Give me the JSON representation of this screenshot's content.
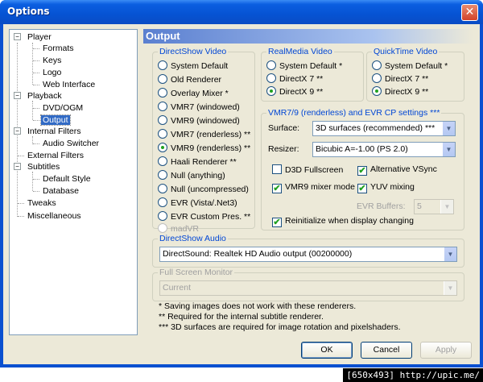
{
  "window": {
    "title": "Options",
    "close_glyph": "✕"
  },
  "tree": {
    "items": [
      {
        "label": "Player",
        "expander": "−"
      },
      {
        "label": "Formats"
      },
      {
        "label": "Keys"
      },
      {
        "label": "Logo"
      },
      {
        "label": "Web Interface"
      },
      {
        "label": "Playback",
        "expander": "−"
      },
      {
        "label": "DVD/OGM"
      },
      {
        "label": "Output",
        "selected": true
      },
      {
        "label": "Internal Filters",
        "expander": "−"
      },
      {
        "label": "Audio Switcher"
      },
      {
        "label": "External Filters"
      },
      {
        "label": "Subtitles",
        "expander": "−"
      },
      {
        "label": "Default Style"
      },
      {
        "label": "Database"
      },
      {
        "label": "Tweaks"
      },
      {
        "label": "Miscellaneous"
      }
    ]
  },
  "page": {
    "title": "Output"
  },
  "directshow_video": {
    "title": "DirectShow Video",
    "options": [
      {
        "label": "System Default",
        "checked": false,
        "enabled": true
      },
      {
        "label": "Old Renderer",
        "checked": false,
        "enabled": true
      },
      {
        "label": "Overlay Mixer *",
        "checked": false,
        "enabled": true
      },
      {
        "label": "VMR7 (windowed)",
        "checked": false,
        "enabled": true
      },
      {
        "label": "VMR9 (windowed)",
        "checked": false,
        "enabled": true
      },
      {
        "label": "VMR7 (renderless) **",
        "checked": false,
        "enabled": true
      },
      {
        "label": "VMR9 (renderless) **",
        "checked": true,
        "enabled": true
      },
      {
        "label": "Haali Renderer **",
        "checked": false,
        "enabled": true
      },
      {
        "label": "Null (anything)",
        "checked": false,
        "enabled": true
      },
      {
        "label": "Null (uncompressed)",
        "checked": false,
        "enabled": true
      },
      {
        "label": "EVR (Vista/.Net3)",
        "checked": false,
        "enabled": true
      },
      {
        "label": "EVR Custom Pres. **",
        "checked": false,
        "enabled": true
      },
      {
        "label": "madVR",
        "checked": false,
        "enabled": false
      }
    ]
  },
  "realmedia_video": {
    "title": "RealMedia Video",
    "options": [
      {
        "label": "System Default *",
        "checked": false
      },
      {
        "label": "DirectX 7 **",
        "checked": false
      },
      {
        "label": "DirectX 9 **",
        "checked": true
      }
    ]
  },
  "quicktime_video": {
    "title": "QuickTime Video",
    "options": [
      {
        "label": "System Default *",
        "checked": false
      },
      {
        "label": "DirectX 7 **",
        "checked": false
      },
      {
        "label": "DirectX 9 **",
        "checked": true
      }
    ]
  },
  "vmr_settings": {
    "title": "VMR7/9 (renderless) and EVR CP settings ***",
    "surface_label": "Surface:",
    "surface_value": "3D surfaces (recommended) ***",
    "resizer_label": "Resizer:",
    "resizer_value": "Bicubic A=-1.00 (PS 2.0)",
    "d3d_fullscreen": {
      "label": "D3D Fullscreen",
      "checked": false
    },
    "alt_vsync": {
      "label": "Alternative VSync",
      "checked": true
    },
    "vmr9_mixer": {
      "label": "VMR9 mixer mode",
      "checked": true
    },
    "yuv_mixing": {
      "label": "YUV mixing",
      "checked": true
    },
    "evr_buffers_label": "EVR Buffers:",
    "evr_buffers_value": "5",
    "reinit": {
      "label": "Reinitialize when display changing",
      "checked": true
    }
  },
  "directshow_audio": {
    "title": "DirectShow Audio",
    "value": "DirectSound: Realtek HD Audio output (00200000)"
  },
  "fullscreen_monitor": {
    "title": "Full Screen Monitor",
    "value": "Current"
  },
  "notes": [
    "* Saving images does not work with these renderers.",
    "** Required for the internal subtitle renderer.",
    "*** 3D surfaces are required for image rotation and pixelshaders."
  ],
  "buttons": {
    "ok": "OK",
    "cancel": "Cancel",
    "apply": "Apply"
  },
  "caption": "[650x493] http://upic.me/",
  "icons": {
    "check": "✔",
    "dropdown": "▼"
  },
  "colors": {
    "group_title": "#0046d5",
    "selection": "#316ac5",
    "titlebar": "#0653d3"
  }
}
